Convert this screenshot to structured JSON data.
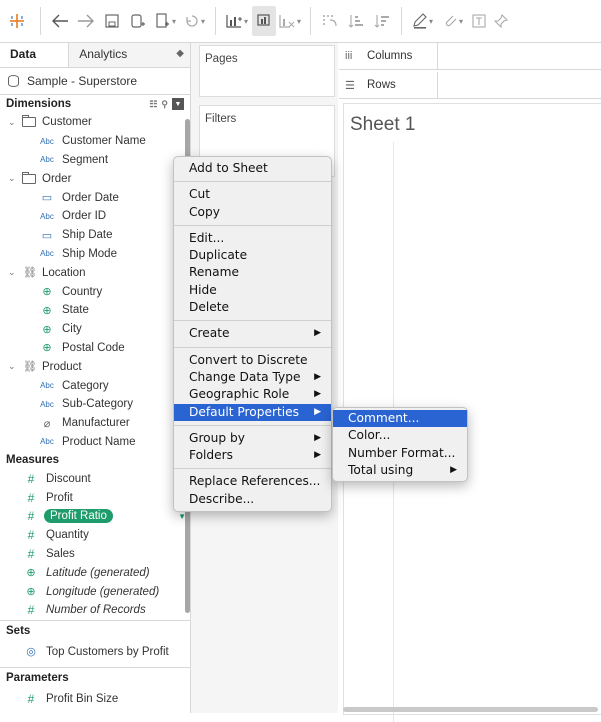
{
  "colors": {
    "accent_green": "#1f9c6b",
    "field_blue": "#2f6fb3",
    "menu_highlight": "#2a64d2",
    "toolbar_logo": "#e67e22"
  },
  "toolbar": {
    "icons": [
      "tableau-logo-icon",
      "back-arrow-icon",
      "forward-arrow-icon",
      "save-icon",
      "new-data-source-icon",
      "new-worksheet-icon",
      "undo-icon",
      "new-worksheet-chart-icon",
      "duplicate-sheet-icon",
      "clear-sheet-icon",
      "swap-icon",
      "sort-ascending-icon",
      "sort-descending-icon",
      "highlight-icon",
      "group-icon",
      "label-icon",
      "pin-icon"
    ]
  },
  "data_pane": {
    "tabs": {
      "data": "Data",
      "analytics": "Analytics"
    },
    "data_source": "Sample - Superstore",
    "dimensions_header": "Dimensions",
    "dimensions": [
      {
        "type": "folder",
        "label": "Customer"
      },
      {
        "type": "abc",
        "label": "Customer Name"
      },
      {
        "type": "abc",
        "label": "Segment"
      },
      {
        "type": "folder",
        "label": "Order"
      },
      {
        "type": "date",
        "label": "Order Date"
      },
      {
        "type": "abc",
        "label": "Order ID"
      },
      {
        "type": "date",
        "label": "Ship Date"
      },
      {
        "type": "abc",
        "label": "Ship Mode"
      },
      {
        "type": "hierarchy",
        "label": "Location"
      },
      {
        "type": "geo",
        "label": "Country"
      },
      {
        "type": "geo",
        "label": "State"
      },
      {
        "type": "geo",
        "label": "City"
      },
      {
        "type": "geo",
        "label": "Postal Code"
      },
      {
        "type": "hierarchy",
        "label": "Product"
      },
      {
        "type": "abc",
        "label": "Category"
      },
      {
        "type": "abc",
        "label": "Sub-Category"
      },
      {
        "type": "clip",
        "label": "Manufacturer"
      },
      {
        "type": "abc",
        "label": "Product Name"
      }
    ],
    "abc_glyph": "Abc",
    "measures_header": "Measures",
    "measures": [
      {
        "label": "Discount",
        "italic": false
      },
      {
        "label": "Profit",
        "italic": false
      },
      {
        "label": "Profit Ratio",
        "italic": false,
        "selected": true
      },
      {
        "label": "Quantity",
        "italic": false
      },
      {
        "label": "Sales",
        "italic": false
      },
      {
        "label": "Latitude (generated)",
        "italic": true
      },
      {
        "label": "Longitude (generated)",
        "italic": true
      },
      {
        "label": "Number of Records",
        "italic": true
      }
    ],
    "sets_header": "Sets",
    "sets": [
      {
        "label": "Top Customers by Profit"
      }
    ],
    "parameters_header": "Parameters",
    "parameters": [
      {
        "label": "Profit Bin Size"
      }
    ]
  },
  "cards": {
    "pages": "Pages",
    "filters": "Filters"
  },
  "shelves": {
    "columns": "Columns",
    "rows": "Rows"
  },
  "sheet": {
    "title": "Sheet 1"
  },
  "context_menu": {
    "groups": [
      [
        {
          "label": "Add to Sheet"
        }
      ],
      [
        {
          "label": "Cut"
        },
        {
          "label": "Copy"
        }
      ],
      [
        {
          "label": "Edit..."
        },
        {
          "label": "Duplicate"
        },
        {
          "label": "Rename"
        },
        {
          "label": "Hide"
        },
        {
          "label": "Delete"
        }
      ],
      [
        {
          "label": "Create",
          "submenu": true
        }
      ],
      [
        {
          "label": "Convert to Discrete"
        },
        {
          "label": "Change Data Type",
          "submenu": true
        },
        {
          "label": "Geographic Role",
          "submenu": true
        },
        {
          "label": "Default Properties",
          "submenu": true,
          "highlighted": true
        }
      ],
      [
        {
          "label": "Group by",
          "submenu": true
        },
        {
          "label": "Folders",
          "submenu": true
        }
      ],
      [
        {
          "label": "Replace References..."
        },
        {
          "label": "Describe..."
        }
      ]
    ]
  },
  "submenu": {
    "items": [
      {
        "label": "Comment...",
        "highlighted": true
      },
      {
        "label": "Color..."
      },
      {
        "label": "Number Format..."
      },
      {
        "label": "Total using",
        "submenu": true
      }
    ]
  }
}
